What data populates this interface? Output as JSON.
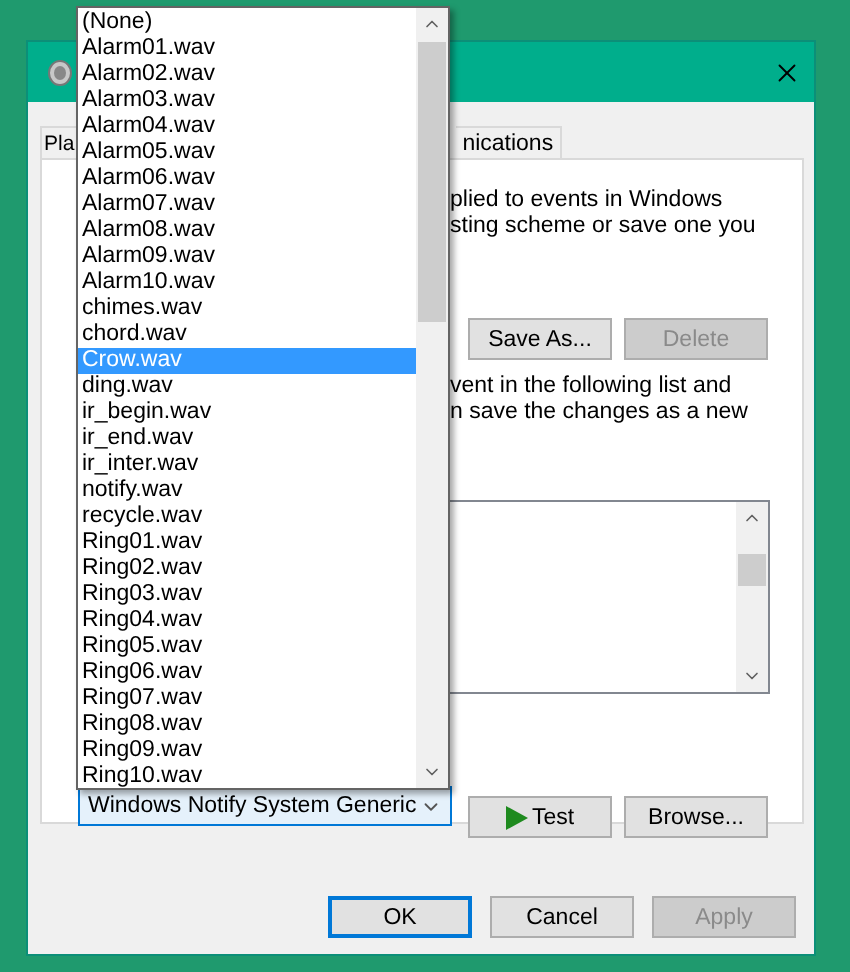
{
  "tabs": [
    {
      "label": "Pla",
      "selected": false
    },
    {
      "label": "nications",
      "selected": false
    }
  ],
  "description": [
    "plied to events in Windows",
    "sting scheme or save one you"
  ],
  "scheme_buttons": [
    {
      "label": "Save As...",
      "disabled": false
    },
    {
      "label": "Delete",
      "disabled": true
    }
  ],
  "instructions": [
    "vent in the following list and",
    "n save the changes as a new"
  ],
  "sound_select": {
    "value": "Windows Notify System Generic",
    "expanded": true,
    "options": [
      {
        "label": "(None)",
        "selected": false
      },
      {
        "label": "Alarm01.wav",
        "selected": false
      },
      {
        "label": "Alarm02.wav",
        "selected": false
      },
      {
        "label": "Alarm03.wav",
        "selected": false
      },
      {
        "label": "Alarm04.wav",
        "selected": false
      },
      {
        "label": "Alarm05.wav",
        "selected": false
      },
      {
        "label": "Alarm06.wav",
        "selected": false
      },
      {
        "label": "Alarm07.wav",
        "selected": false
      },
      {
        "label": "Alarm08.wav",
        "selected": false
      },
      {
        "label": "Alarm09.wav",
        "selected": false
      },
      {
        "label": "Alarm10.wav",
        "selected": false
      },
      {
        "label": "chimes.wav",
        "selected": false
      },
      {
        "label": "chord.wav",
        "selected": false
      },
      {
        "label": "Crow.wav",
        "selected": true
      },
      {
        "label": "ding.wav",
        "selected": false
      },
      {
        "label": "ir_begin.wav",
        "selected": false
      },
      {
        "label": "ir_end.wav",
        "selected": false
      },
      {
        "label": "ir_inter.wav",
        "selected": false
      },
      {
        "label": "notify.wav",
        "selected": false
      },
      {
        "label": "recycle.wav",
        "selected": false
      },
      {
        "label": "Ring01.wav",
        "selected": false
      },
      {
        "label": "Ring02.wav",
        "selected": false
      },
      {
        "label": "Ring03.wav",
        "selected": false
      },
      {
        "label": "Ring04.wav",
        "selected": false
      },
      {
        "label": "Ring05.wav",
        "selected": false
      },
      {
        "label": "Ring06.wav",
        "selected": false
      },
      {
        "label": "Ring07.wav",
        "selected": false
      },
      {
        "label": "Ring08.wav",
        "selected": false
      },
      {
        "label": "Ring09.wav",
        "selected": false
      },
      {
        "label": "Ring10.wav",
        "selected": false
      }
    ]
  },
  "sound_buttons": [
    {
      "kind": "play",
      "label": "Test"
    },
    {
      "kind": "plain",
      "label": "Browse..."
    }
  ],
  "dialog_buttons": [
    {
      "label": "OK",
      "default": true,
      "disabled": false
    },
    {
      "label": "Cancel",
      "default": false,
      "disabled": false
    },
    {
      "label": "Apply",
      "default": false,
      "disabled": true
    }
  ]
}
